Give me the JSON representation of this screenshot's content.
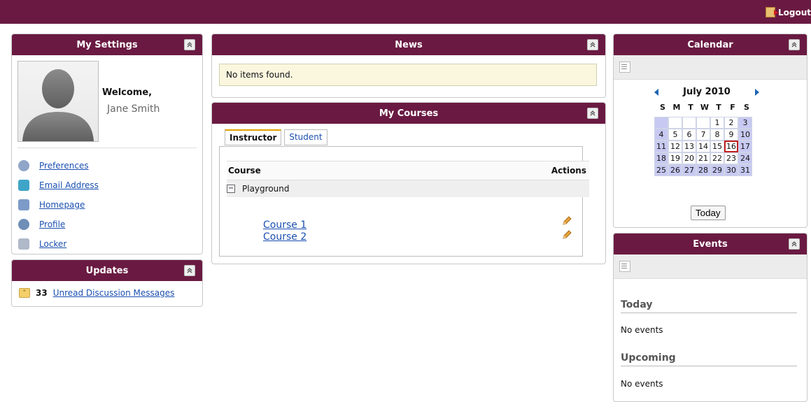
{
  "header": {
    "logout_label": "Logout"
  },
  "settings": {
    "title": "My Settings",
    "welcome": "Welcome,",
    "user_name": "Jane Smith",
    "links": [
      {
        "label": "Preferences",
        "icon": "preferences-icon"
      },
      {
        "label": "Email Address",
        "icon": "email-icon"
      },
      {
        "label": "Homepage",
        "icon": "home-icon"
      },
      {
        "label": "Profile",
        "icon": "profile-icon"
      },
      {
        "label": "Locker",
        "icon": "locker-icon"
      }
    ]
  },
  "updates": {
    "title": "Updates",
    "count": "33",
    "link": "Unread Discussion Messages"
  },
  "news": {
    "title": "News",
    "empty": "No items found."
  },
  "courses": {
    "title": "My Courses",
    "tabs": [
      "Instructor",
      "Student"
    ],
    "active_tab": "Instructor",
    "col_course": "Course",
    "col_actions": "Actions",
    "group": "Playground",
    "items": [
      "Course 1",
      "Course 2"
    ]
  },
  "calendar": {
    "title": "Calendar",
    "month": "July 2010",
    "dow": [
      "S",
      "M",
      "T",
      "W",
      "T",
      "F",
      "S"
    ],
    "weeks": [
      [
        "",
        "",
        "",
        "",
        "1",
        "2",
        "3"
      ],
      [
        "4",
        "5",
        "6",
        "7",
        "8",
        "9",
        "10"
      ],
      [
        "11",
        "12",
        "13",
        "14",
        "15",
        "16",
        "17"
      ],
      [
        "18",
        "19",
        "20",
        "21",
        "22",
        "23",
        "24"
      ],
      [
        "25",
        "26",
        "27",
        "28",
        "29",
        "30",
        "31"
      ]
    ],
    "today_day": "16",
    "today_label": "Today"
  },
  "events": {
    "title": "Events",
    "today_title": "Today",
    "today_text": "No events",
    "upcoming_title": "Upcoming",
    "upcoming_text": "No events"
  },
  "colors": {
    "brand": "#6a1a42",
    "link": "#1a4fb0",
    "calendar_weekend": "#c8c9f2",
    "today_border": "#c21f1f"
  }
}
